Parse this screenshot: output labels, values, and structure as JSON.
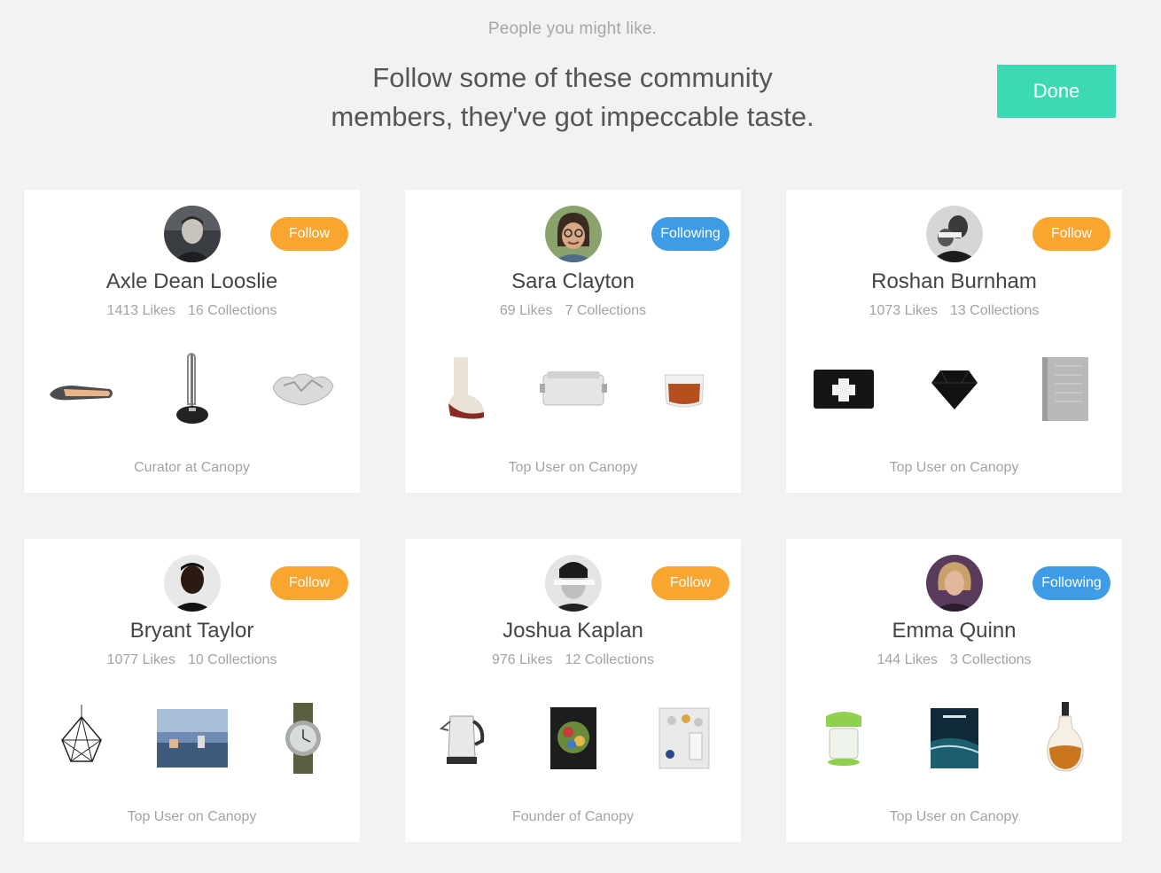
{
  "header": {
    "subtitle": "People you might like.",
    "headline_line1": "Follow some of these community",
    "headline_line2": "members, they've got impeccable taste.",
    "done_label": "Done"
  },
  "colors": {
    "accent_done": "#3dd9b4",
    "follow": "#f9a630",
    "following": "#3e9be6"
  },
  "users": [
    {
      "name": "Axle Dean Looslie",
      "likes": "1413 Likes",
      "collections": "16 Collections",
      "button": "Follow",
      "state": "follow",
      "role": "Curator at Canopy",
      "products": [
        "wooden-shoe-horn",
        "paper-towel-holder",
        "crumpled-metal-bowl"
      ]
    },
    {
      "name": "Sara Clayton",
      "likes": "69 Likes",
      "collections": "7 Collections",
      "button": "Following",
      "state": "following",
      "role": "Top User on Canopy",
      "products": [
        "wool-slipper-sock",
        "steel-lunch-box",
        "glass-tea-cup"
      ]
    },
    {
      "name": "Roshan Burnham",
      "likes": "1073 Likes",
      "collections": "13 Collections",
      "button": "Follow",
      "state": "follow",
      "role": "Top User on Canopy",
      "products": [
        "black-first-aid-pouch",
        "black-gem-object",
        "grey-notebook"
      ]
    },
    {
      "name": "Bryant Taylor",
      "likes": "1077 Likes",
      "collections": "10 Collections",
      "button": "Follow",
      "state": "follow",
      "role": "Top User on Canopy",
      "products": [
        "geometric-pendant-lamp",
        "landscape-photo-print",
        "field-watch"
      ]
    },
    {
      "name": "Joshua Kaplan",
      "likes": "976 Likes",
      "collections": "12 Collections",
      "button": "Follow",
      "state": "follow",
      "role": "Founder of Canopy",
      "products": [
        "glass-electric-kettle",
        "cookbook",
        "art-print-book"
      ]
    },
    {
      "name": "Emma Quinn",
      "likes": "144 Likes",
      "collections": "3 Collections",
      "button": "Following",
      "state": "following",
      "role": "Top User on Canopy",
      "products": [
        "green-spiralizer",
        "overview-book",
        "glass-decanter"
      ]
    }
  ]
}
